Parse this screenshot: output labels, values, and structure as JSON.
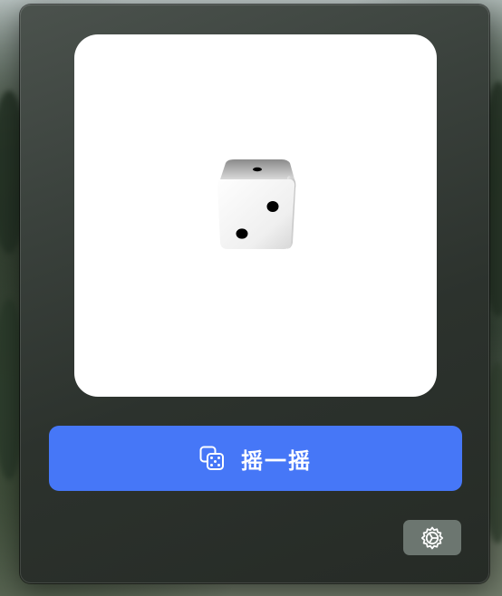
{
  "app": {
    "roll_button_label": "摇一摇",
    "roll_button_icon": "dice-icon",
    "settings_icon": "gear-icon"
  },
  "dice": {
    "top_face_value": 1,
    "front_face_value": 2
  },
  "colors": {
    "accent": "#4677f7",
    "window_bg": "#2c322d",
    "card_bg": "#ffffff",
    "settings_button_bg": "#6c7670"
  }
}
